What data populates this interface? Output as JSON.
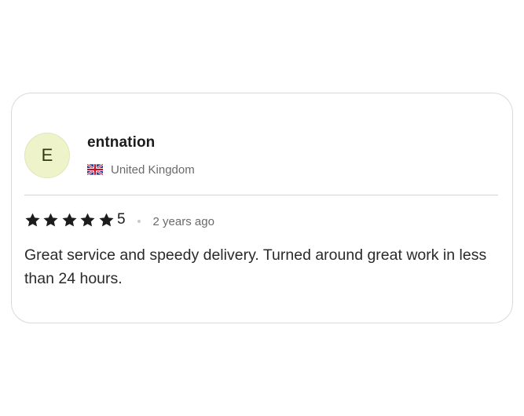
{
  "review": {
    "avatar_initial": "E",
    "reviewer_name": "entnation",
    "country": {
      "flag_icon": "uk-flag-icon",
      "label": "United Kingdom"
    },
    "rating": {
      "value": "5",
      "max": 5,
      "star_icon": "star-icon",
      "star_color": "#1c1c1c"
    },
    "date": "2 years ago",
    "text": "Great service and speedy delivery. Turned around great work in less than 24 hours."
  },
  "colors": {
    "avatar_bg": "#eef3c9",
    "card_border": "#d9d9d9",
    "muted_text": "#6a6a6a"
  }
}
